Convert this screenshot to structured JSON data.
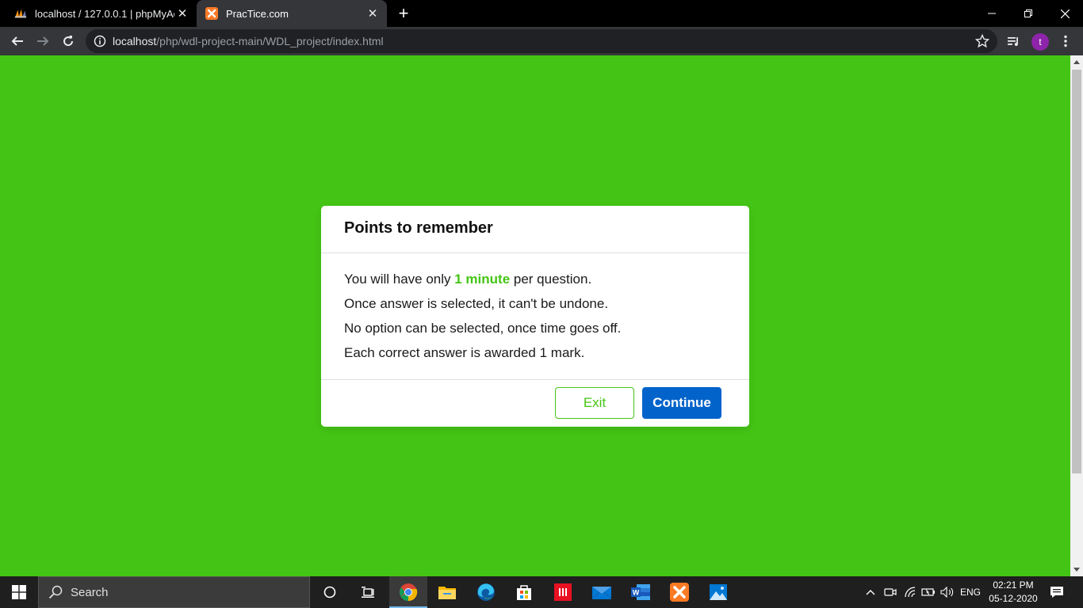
{
  "browser": {
    "tabs": [
      {
        "title": "localhost / 127.0.0.1 | phpMyAdmin",
        "favicon": "phpmyadmin-icon",
        "active": false
      },
      {
        "title": "PracTice.com",
        "favicon": "xampp-icon",
        "active": true
      }
    ],
    "url_host": "localhost",
    "url_path": "/php/wdl-project-main/WDL_project/index.html",
    "profile_initial": "t",
    "close_glyph": "✕",
    "new_tab_glyph": "+"
  },
  "page": {
    "background_color": "#44c515",
    "dialog": {
      "title": "Points to remember",
      "rules": {
        "line1_before": "You will have only ",
        "line1_highlight": "1 minute",
        "line1_after": " per question.",
        "line2": "Once answer is selected, it can't be undone.",
        "line3": "No option can be selected, once time goes off.",
        "line4": "Each correct answer is awarded 1 mark."
      },
      "exit_label": "Exit",
      "continue_label": "Continue",
      "accent_color": "#44c515",
      "primary_color": "#0263ca"
    }
  },
  "taskbar": {
    "search_label": "Search",
    "language": "ENG",
    "time": "02:21 PM",
    "date": "05-12-2020",
    "pinned": [
      "chrome-icon",
      "file-explorer-icon",
      "edge-icon",
      "store-icon",
      "app-icon",
      "mail-icon",
      "word-icon",
      "xampp-icon",
      "photos-icon"
    ]
  }
}
